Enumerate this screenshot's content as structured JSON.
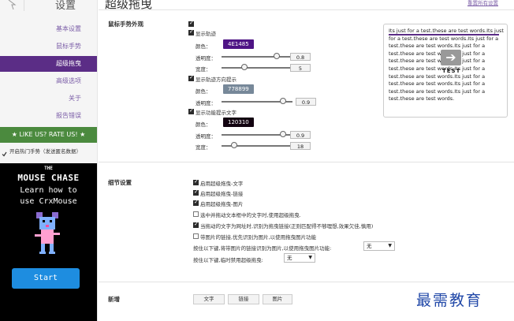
{
  "sidebar": {
    "title": "设置",
    "nav": [
      "基本设置",
      "鼠标手势",
      "超级拖曳",
      "高级选项",
      "关于",
      "报告错误"
    ],
    "active_index": 2,
    "rate": "★ LIKE US? RATE US! ★",
    "hot_gesture": {
      "checked": true,
      "label": "开启热门手势（发送匿名数据）"
    }
  },
  "ad": {
    "the": "THE",
    "title": "MOUSE CHASE",
    "line1": "Learn how to",
    "line2": "use CrxMouse",
    "button": "Start"
  },
  "main": {
    "title": "超级拖曳",
    "top_link": "重置所有设置"
  },
  "gesture": {
    "section": "鼠标手势外观",
    "top_checked": true,
    "trail": {
      "label": "显示轨迹",
      "checked": true,
      "color_label": "颜色：",
      "color": "4E1485",
      "opacity_label": "透明度：",
      "opacity": "0.8",
      "opacity_fraction": 0.8,
      "width_label": "宽度：",
      "width": "5",
      "width_fraction": 0.3
    },
    "direction": {
      "label": "显示轨迹方向提示",
      "checked": true,
      "color_label": "颜色：",
      "color": "778899",
      "opacity_label": "透明度：",
      "opacity": "0.9",
      "opacity_fraction": 0.9
    },
    "action": {
      "label": "显示功能提示文字",
      "checked": true,
      "color_label": "颜色：",
      "color": "120310",
      "opacity_label": "透明度：",
      "opacity": "0.9",
      "opacity_fraction": 0.9,
      "width_label": "宽度：",
      "width": "18",
      "width_fraction": 0.15
    }
  },
  "preview": {
    "text": "Its just for a test.these are test words.Its just for a test.these are test words.Its just for a test.these are test words.Its just for a test.these are test words.Its just for a test.these are test words.Its just for a test.these are test words.Its just for a test.these are test words.Its just for a test.these are test words.Its just for a test.these are test words.Its just for a test.these are test words.",
    "arrow": "➔",
    "label": "TEST"
  },
  "detail": {
    "section": "细节设置",
    "options": [
      {
        "label": "启用超级拖曳-文字",
        "checked": true
      },
      {
        "label": "启用超级拖曳-链接",
        "checked": true
      },
      {
        "label": "启用超级拖曳-图片",
        "checked": true
      },
      {
        "label": "选中并拖动文本框中的文字时,使用超级拖曳.",
        "checked": false
      },
      {
        "label": "当拖动的文字为网址时,识别为拖曳链接(正则匹配得不够理想,效果欠佳,慎用)",
        "checked": true
      },
      {
        "label": "带图片的链接,优先识别为图片,以使用拖曳图片功能",
        "checked": false
      }
    ],
    "key1": {
      "label": "按住以下键,将带图片的链接识别为图片,以使用拖曳图片功能:",
      "value": "无"
    },
    "key2": {
      "label": "按住以下键,临时禁用超级拖曳:",
      "value": "无"
    }
  },
  "new": {
    "section": "新增",
    "buttons": [
      "文字",
      "链接",
      "图片"
    ]
  },
  "watermark": "最需教育",
  "colors": {
    "accent": "#5b2d86",
    "rate_bar": "#4b8a3e",
    "ad_button": "#1e8de0",
    "watermark": "#2148a8"
  }
}
